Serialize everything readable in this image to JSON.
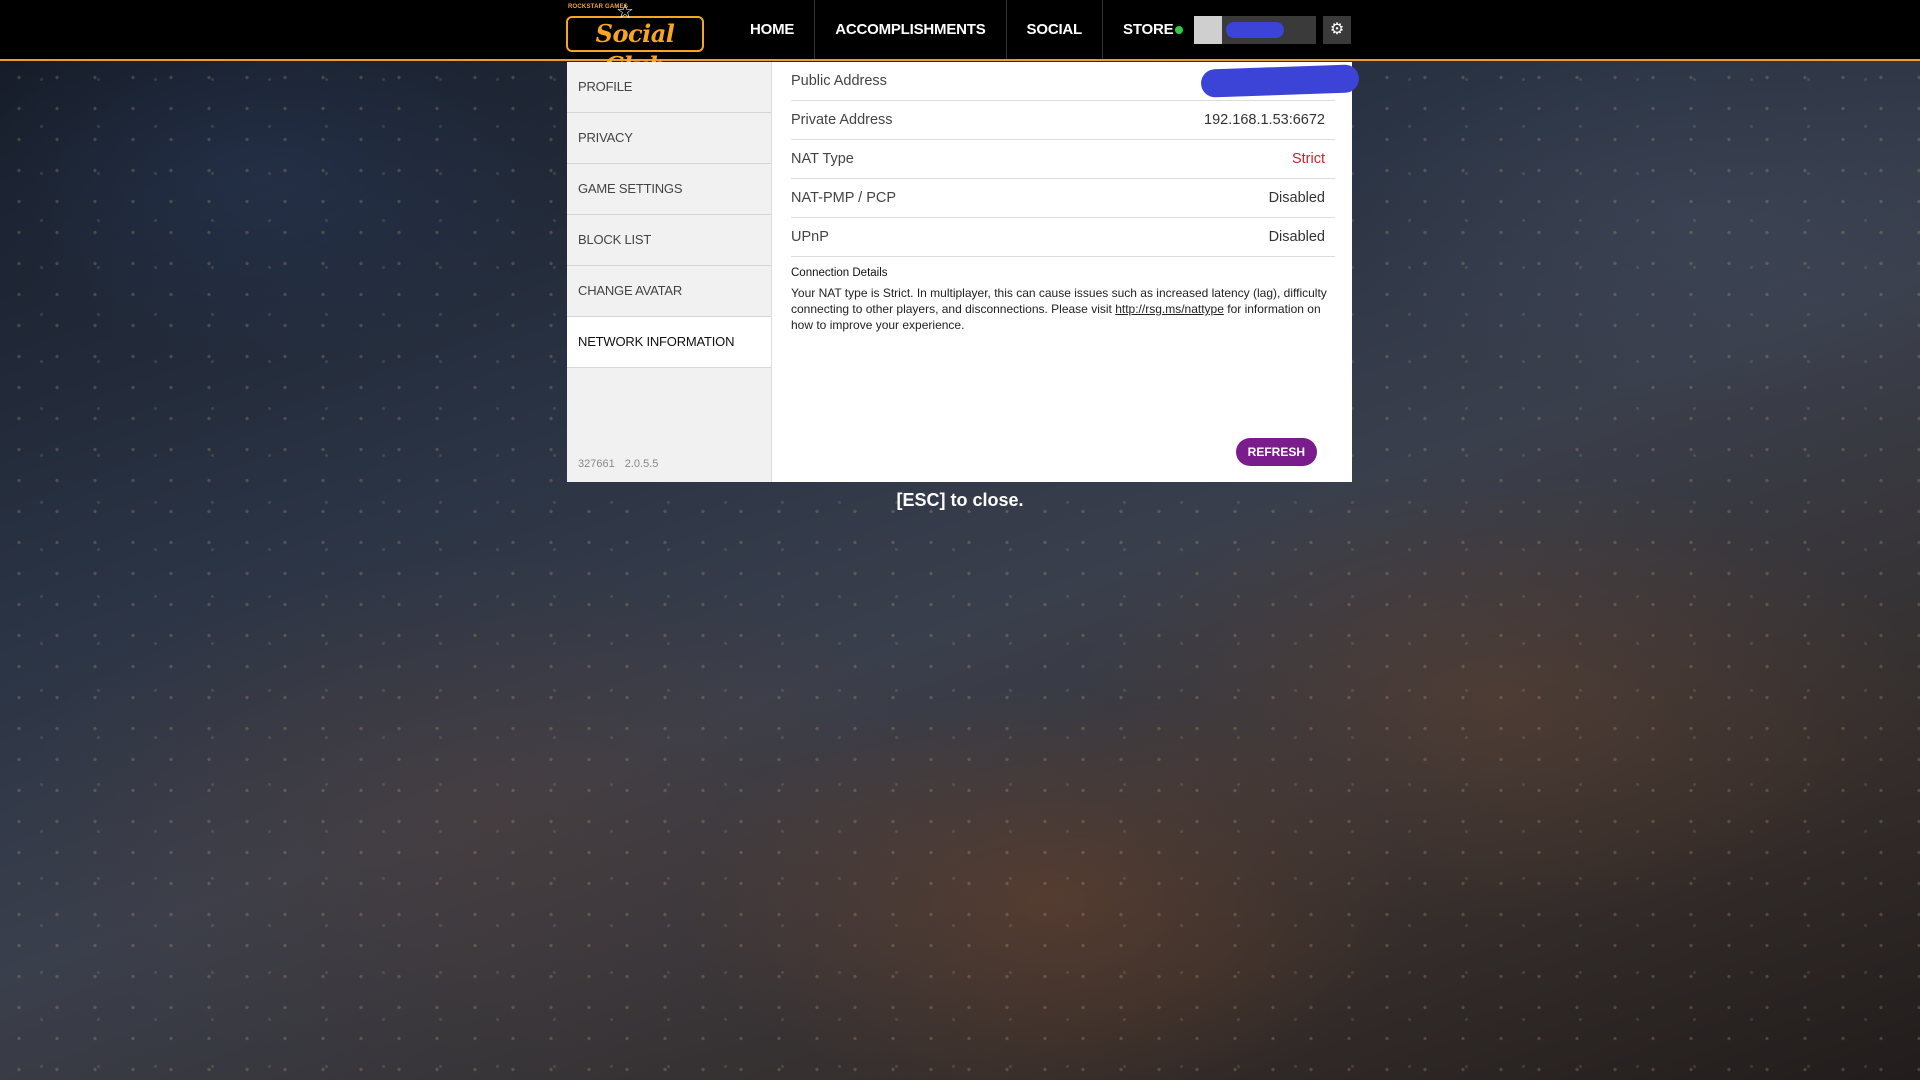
{
  "header": {
    "logo_small": "ROCKSTAR GAMES",
    "logo_text": "Social Club",
    "nav": [
      "HOME",
      "ACCOMPLISHMENTS",
      "SOCIAL",
      "STORE"
    ],
    "status_color": "#2ecc40",
    "settings_icon": "gear-icon"
  },
  "sidebar": {
    "items": [
      "PROFILE",
      "PRIVACY",
      "GAME SETTINGS",
      "BLOCK LIST",
      "CHANGE AVATAR",
      "NETWORK INFORMATION"
    ],
    "active": "NETWORK INFORMATION",
    "build_number": "327661",
    "version": "2.0.5.5"
  },
  "network": {
    "rows": [
      {
        "label": "Public Address",
        "value": ""
      },
      {
        "label": "Private Address",
        "value": "192.168.1.53:6672"
      },
      {
        "label": "NAT Type",
        "value": "Strict"
      },
      {
        "label": "NAT-PMP / PCP",
        "value": "Disabled"
      },
      {
        "label": "UPnP",
        "value": "Disabled"
      }
    ],
    "details_title": "Connection Details",
    "details_text_before": "Your NAT type is Strict. In multiplayer, this can cause issues such as increased latency (lag), difficulty connecting to other players, and disconnections. Please visit ",
    "details_link": "http://rsg.ms/nattype",
    "details_text_after": " for information on how to improve your experience.",
    "refresh_label": "REFRESH"
  },
  "footer": {
    "esc_hint": "[ESC] to close."
  },
  "colors": {
    "accent": "#f6a623",
    "refresh": "#7b1c8c",
    "strict": "#c0282c"
  }
}
